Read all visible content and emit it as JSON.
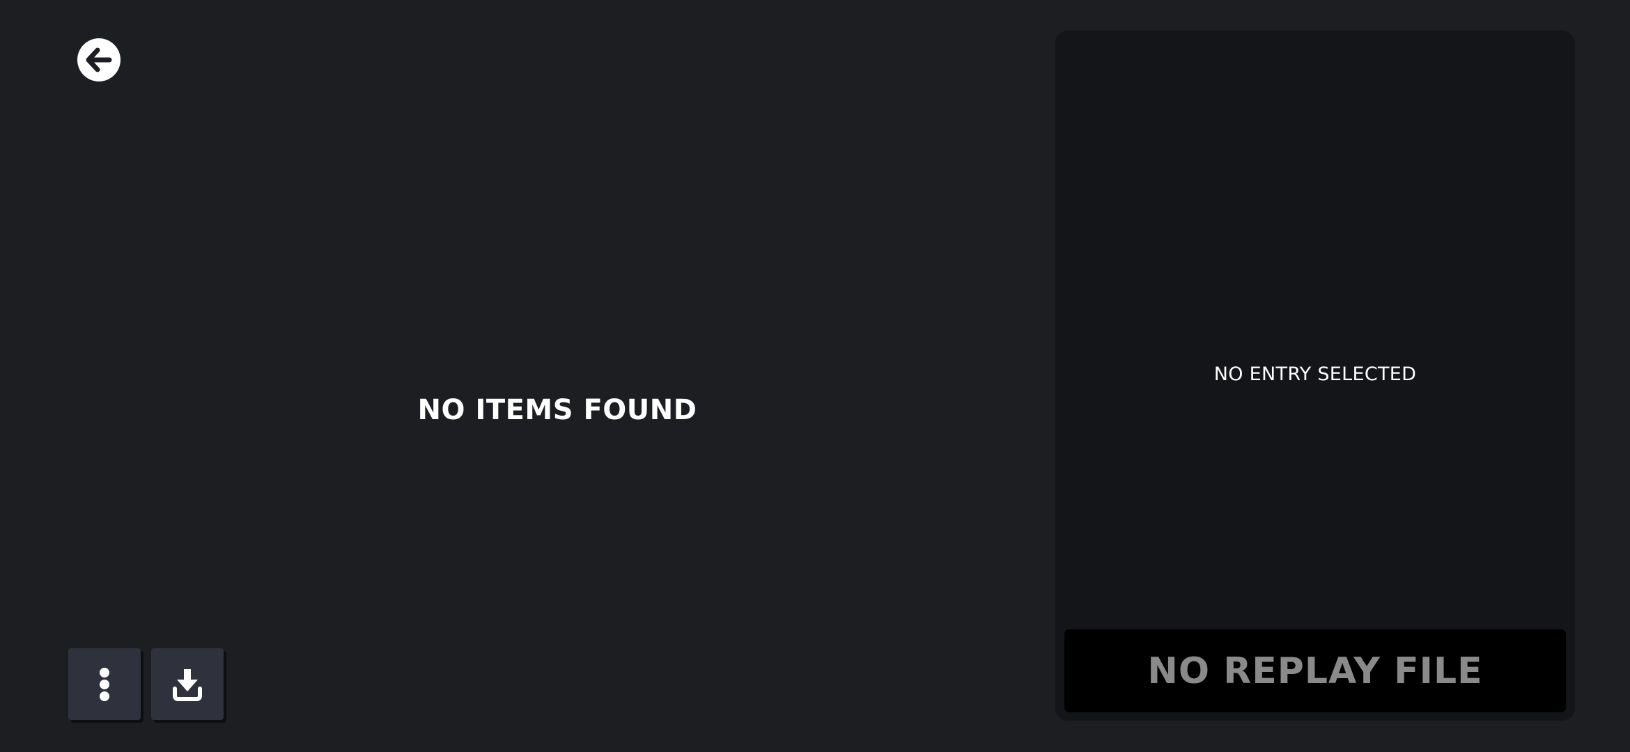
{
  "main": {
    "empty_message": "NO ITEMS FOUND"
  },
  "toolbar": {
    "back_icon": "arrow-left-circle-icon",
    "menu_icon": "more-vertical-icon",
    "import_icon": "download-tray-icon"
  },
  "detail_panel": {
    "empty_message": "NO ENTRY SELECTED",
    "replay_button_label": "NO REPLAY FILE"
  },
  "colors": {
    "background": "#1c1e22",
    "panel": "#141518",
    "button": "#2f323c",
    "replay_button": "#000000",
    "replay_text_disabled": "#8a8a8a",
    "text": "#ffffff"
  }
}
